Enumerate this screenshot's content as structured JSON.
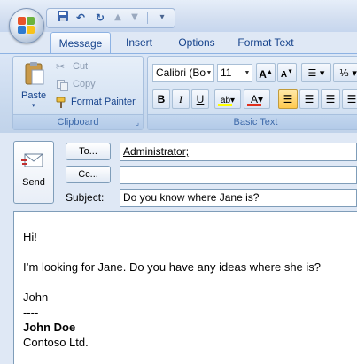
{
  "quick_access": {
    "icons": [
      "save-icon",
      "undo-icon",
      "redo-icon",
      "up-arrow-icon",
      "down-arrow-icon",
      "customize-icon"
    ]
  },
  "tabs": [
    {
      "label": "Message",
      "active": true
    },
    {
      "label": "Insert",
      "active": false
    },
    {
      "label": "Options",
      "active": false
    },
    {
      "label": "Format Text",
      "active": false
    }
  ],
  "clipboard": {
    "paste": "Paste",
    "cut": "Cut",
    "copy": "Copy",
    "format_painter": "Format Painter",
    "group_label": "Clipboard"
  },
  "basic_text": {
    "font_name": "Calibri (Bo",
    "font_size": "11",
    "group_label": "Basic Text"
  },
  "colors": {
    "highlight": "#ffff00",
    "font_color": "#e0301e",
    "accent": "#15428b"
  },
  "compose": {
    "send": "Send",
    "to_button": "To...",
    "cc_button": "Cc...",
    "subject_label": "Subject:",
    "to_value": "Administrator;",
    "cc_value": "",
    "subject_value": "Do you know where Jane is?"
  },
  "body": {
    "greeting": "Hi!",
    "message": "I’m looking for Jane. Do you have any ideas where she is?",
    "sign_name": "John",
    "separator": "----",
    "full_name": "John Doe",
    "company": "Contoso Ltd."
  }
}
